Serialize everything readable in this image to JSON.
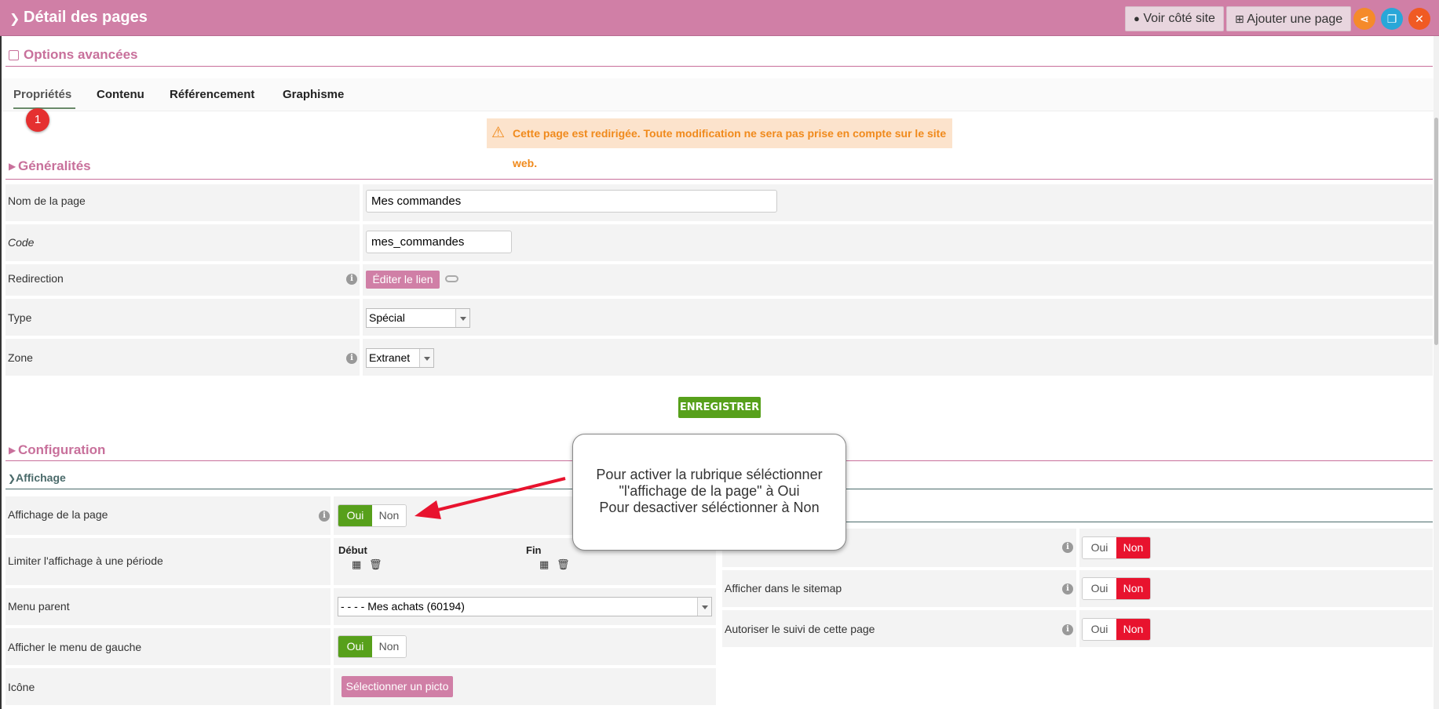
{
  "topbar": {
    "title": "Détail des pages",
    "view_site_label": "Voir côté site",
    "add_page_label": "Ajouter une page"
  },
  "advanced": {
    "title": "Options avancées"
  },
  "tabs": [
    {
      "label": "Propriétés",
      "active": true
    },
    {
      "label": "Contenu"
    },
    {
      "label": "Référencement"
    },
    {
      "label": "Graphisme"
    }
  ],
  "step_badge": "1",
  "warning": "Cette page est redirigée. Toute modification ne sera pas prise en compte sur le site web.",
  "generalites": {
    "title": "Généralités",
    "fields": {
      "name_label": "Nom de la page",
      "name_value": "Mes commandes",
      "code_label": "Code",
      "code_value": "mes_commandes",
      "redirect_label": "Redirection",
      "redirect_button": "Éditer le lien",
      "type_label": "Type",
      "type_value": "Spécial",
      "zone_label": "Zone",
      "zone_value": "Extranet"
    },
    "save_label": "ENREGISTRER"
  },
  "configuration": {
    "title": "Configuration",
    "affichage_title": "Affichage",
    "left": {
      "display_label": "Affichage de la page",
      "period_label": "Limiter l'affichage à une période",
      "start_label": "Début",
      "end_label": "Fin",
      "parent_label": "Menu parent",
      "parent_value": "- - - - Mes achats (60194)",
      "left_menu_label": "Afficher le menu de gauche",
      "icon_label": "Icône",
      "icon_button": "Sélectionner un picto"
    },
    "right": {
      "sitemap_label": "Afficher dans le sitemap",
      "tracking_label": "Autoriser le suivi de cette page"
    },
    "yes": "Oui",
    "no": "Non"
  },
  "callout": {
    "line1": "Pour activer la rubrique séléctionner",
    "line2": "\"l'affichage de la page\" à Oui",
    "line3": "Pour desactiver séléctionner à Non"
  },
  "colors": {
    "accent_pink": "#d07fa6",
    "save_green": "#57a01b",
    "no_red": "#e8132e",
    "warning_orange": "#f08a1c"
  }
}
